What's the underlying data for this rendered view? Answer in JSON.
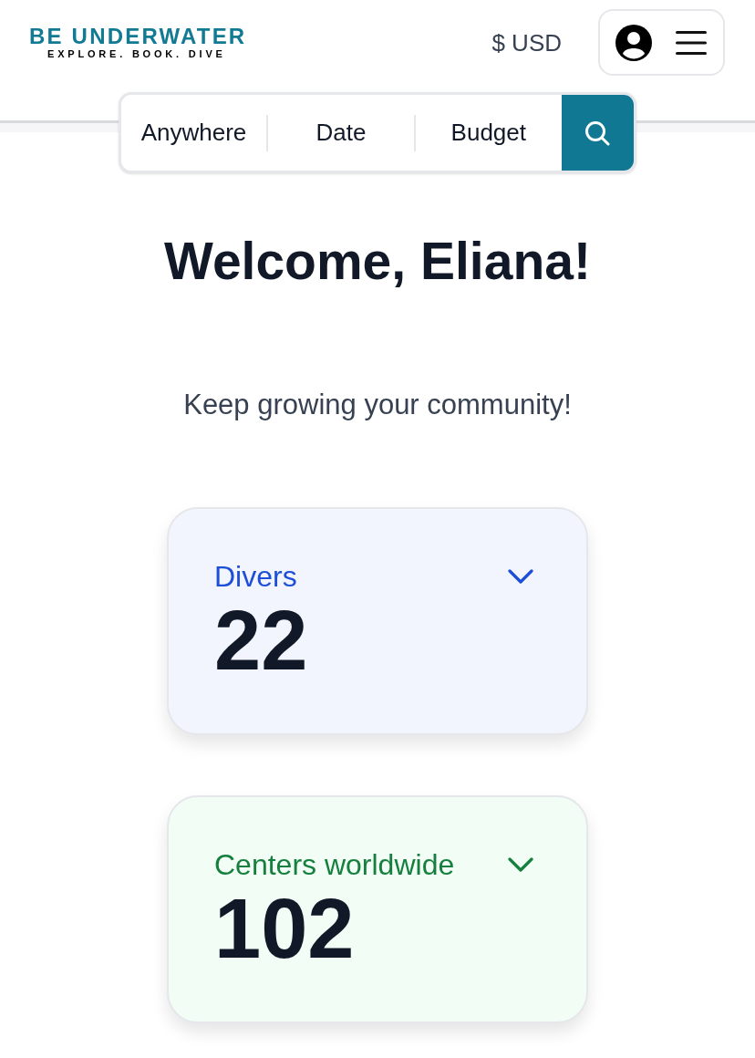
{
  "header": {
    "logo": {
      "name": "BE UNDERWATER",
      "tagline": "EXPLORE. BOOK. DIVE"
    },
    "currency": "$ USD"
  },
  "search": {
    "fields": [
      "Anywhere",
      "Date",
      "Budget"
    ]
  },
  "welcome": {
    "title": "Welcome, Eliana!",
    "subtitle": "Keep growing your community!"
  },
  "stats": [
    {
      "label": "Divers",
      "value": "22",
      "color": "#1d4ed8"
    },
    {
      "label": "Centers worldwide",
      "value": "102",
      "color": "#15803d"
    }
  ]
}
